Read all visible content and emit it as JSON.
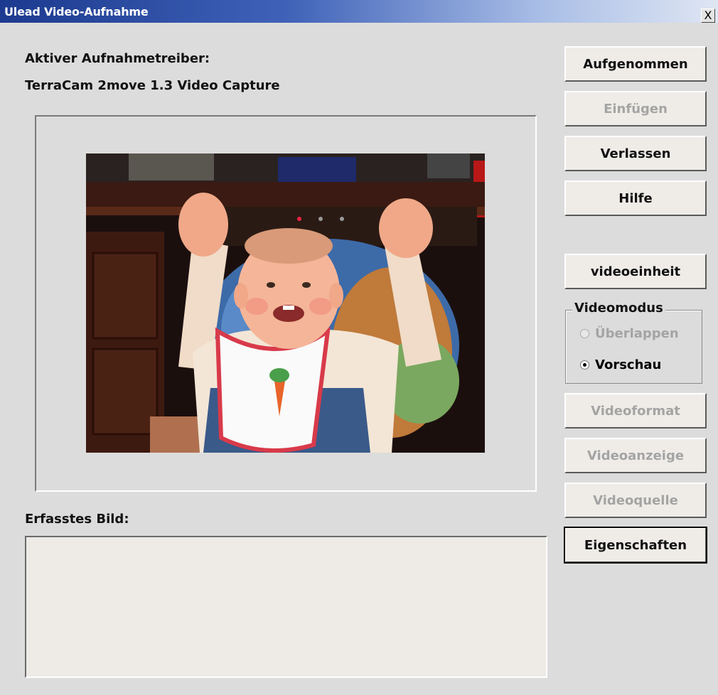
{
  "window": {
    "title": "Ulead Video-Aufnahme",
    "close_glyph": "X"
  },
  "driver": {
    "label": "Aktiver Aufnahmetreiber:",
    "name": "TerraCam 2move 1.3 Video Capture"
  },
  "capture": {
    "label": "Erfasstes Bild:"
  },
  "buttons": {
    "aufgenommen": "Aufgenommen",
    "einfuegen": "Einfügen",
    "verlassen": "Verlassen",
    "hilfe": "Hilfe",
    "videoeinheit": "videoeinheit",
    "videoformat": "Videoformat",
    "videoanzeige": "Videoanzeige",
    "videoquelle": "Videoquelle",
    "eigenschaften": "Eigenschaften"
  },
  "videomodus": {
    "legend": "Videomodus",
    "options": [
      {
        "label": "Überlappen",
        "checked": false,
        "enabled": false
      },
      {
        "label": "Vorschau",
        "checked": true,
        "enabled": true
      }
    ]
  },
  "icons": {
    "close": "close-icon",
    "preview": "video-preview-image"
  }
}
